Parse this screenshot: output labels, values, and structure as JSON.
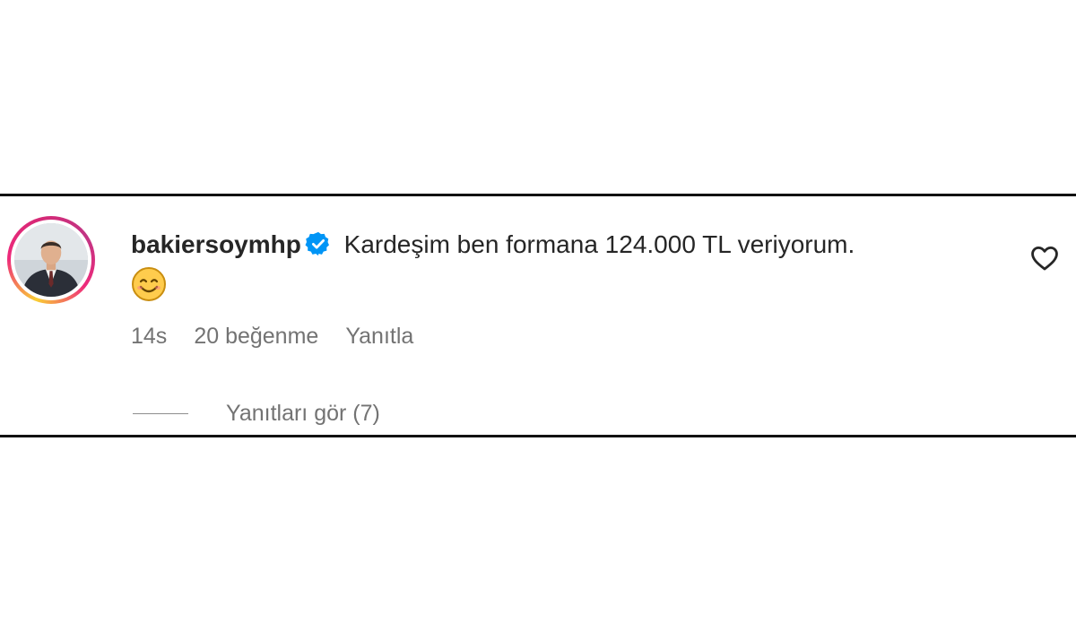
{
  "comment": {
    "username": "bakiersoymhp",
    "verified_icon": "verified-badge-icon",
    "text": "Kardeşim ben formana 124.000 TL veriyorum.",
    "emoji_icon": "smiling-face-emoji",
    "time": "14s",
    "likes": "20 beğenme",
    "reply_label": "Yanıtla",
    "view_replies_label": "Yanıtları gör (7)",
    "like_icon": "heart-outline-icon"
  },
  "colors": {
    "text": "#262626",
    "muted": "#737373",
    "verified": "#0095f6",
    "frame_border": "#111111"
  }
}
